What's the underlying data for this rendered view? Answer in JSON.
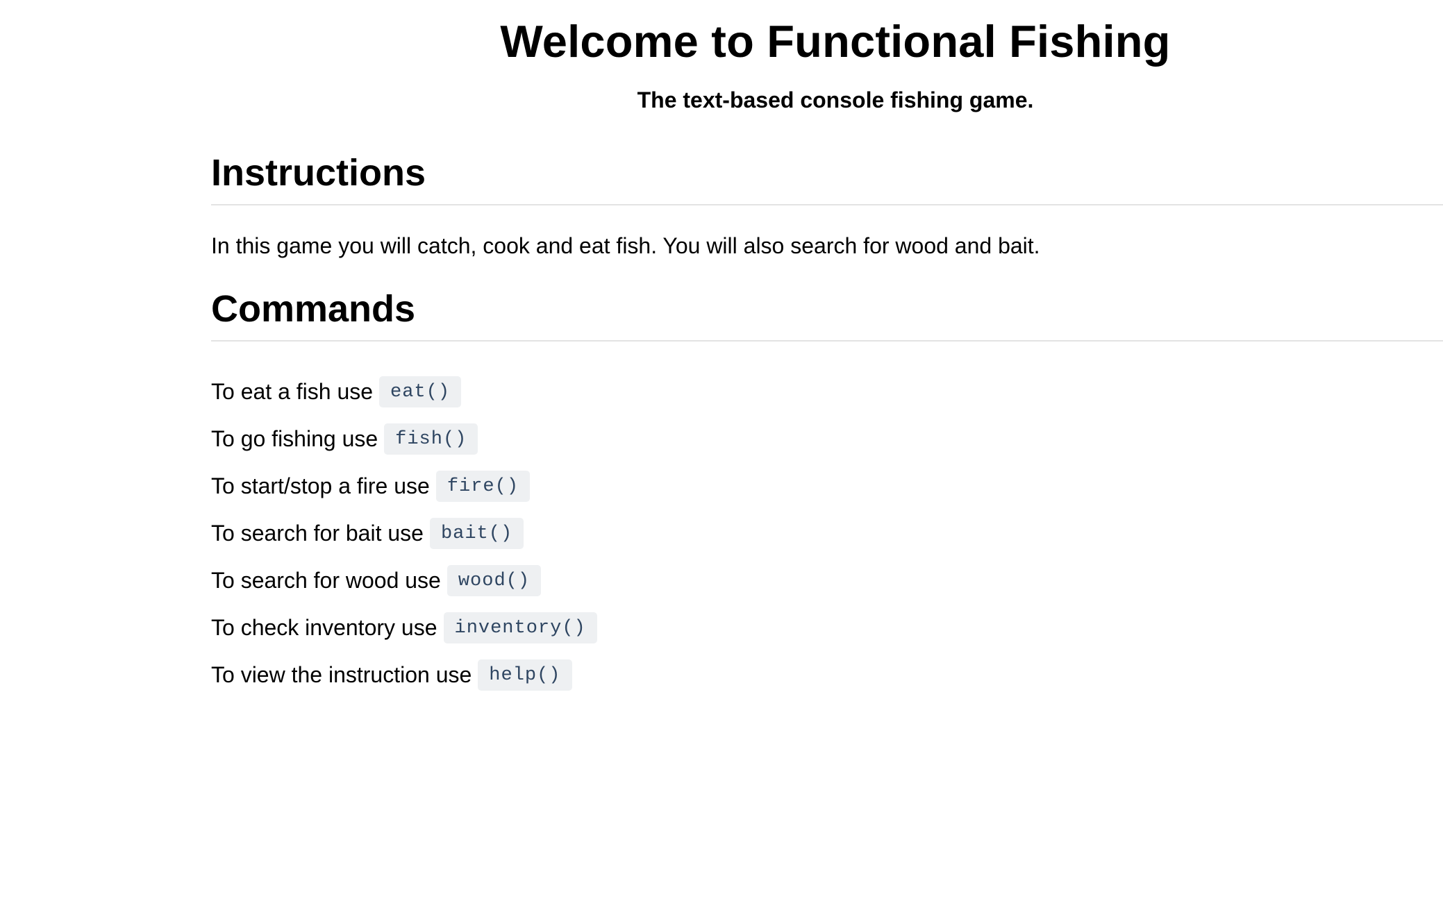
{
  "header": {
    "title": "Welcome to Functional Fishing",
    "subtitle": "The text-based console fishing game."
  },
  "instructions": {
    "heading": "Instructions",
    "text": "In this game you will catch, cook and eat fish. You will also search for wood and bait."
  },
  "commands": {
    "heading": "Commands",
    "items": [
      {
        "text": "To eat a fish use",
        "code": "eat()"
      },
      {
        "text": "To go fishing use",
        "code": "fish()"
      },
      {
        "text": "To start/stop a fire use",
        "code": "fire()"
      },
      {
        "text": "To search for bait use",
        "code": "bait()"
      },
      {
        "text": "To search for wood use",
        "code": "wood()"
      },
      {
        "text": "To check inventory use",
        "code": "inventory()"
      },
      {
        "text": "To view the instruction use",
        "code": "help()"
      }
    ]
  }
}
